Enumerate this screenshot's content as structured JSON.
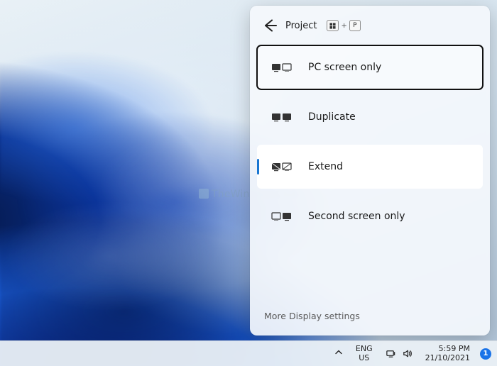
{
  "panel": {
    "title": "Project",
    "key_hint": {
      "modifier": "win",
      "plus": "+",
      "key": "P"
    },
    "options": [
      {
        "label": "PC screen only",
        "state": "focused"
      },
      {
        "label": "Duplicate",
        "state": "default"
      },
      {
        "label": "Extend",
        "state": "selected"
      },
      {
        "label": "Second screen only",
        "state": "default"
      }
    ],
    "footer_link": "More Display settings"
  },
  "taskbar": {
    "language_top": "ENG",
    "language_bottom": "US",
    "time": "5:59 PM",
    "date": "21/10/2021",
    "notification_count": "1"
  },
  "watermark": "TheWindowsClub"
}
